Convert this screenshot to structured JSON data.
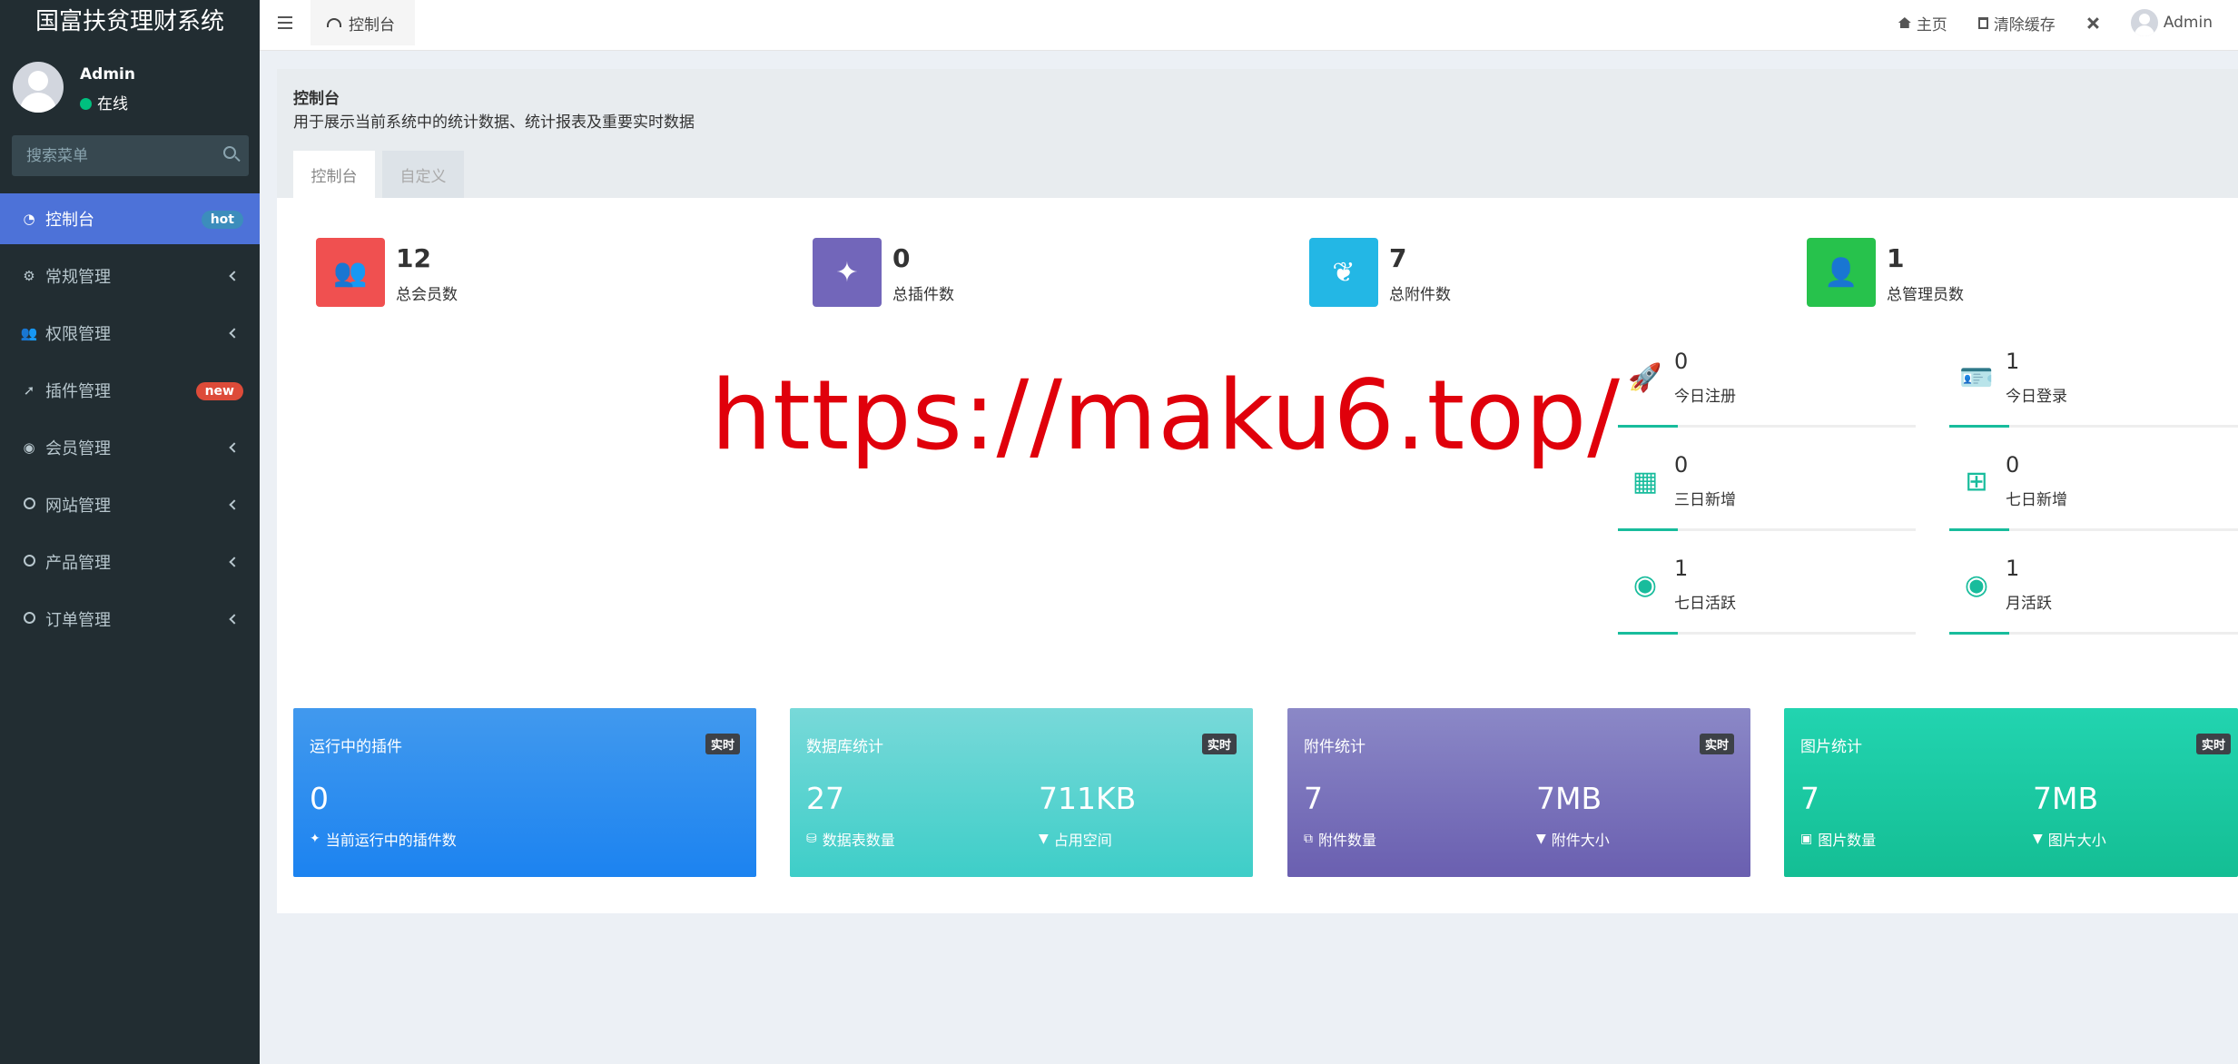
{
  "app": {
    "title": "国富扶贫理财系统"
  },
  "user": {
    "name": "Admin",
    "status": "在线"
  },
  "search": {
    "placeholder": "搜索菜单"
  },
  "menu": [
    {
      "label": "控制台",
      "badge": "hot"
    },
    {
      "label": "常规管理"
    },
    {
      "label": "权限管理"
    },
    {
      "label": "插件管理",
      "badge": "new"
    },
    {
      "label": "会员管理"
    },
    {
      "label": "网站管理"
    },
    {
      "label": "产品管理"
    },
    {
      "label": "订单管理"
    }
  ],
  "header": {
    "tab": "控制台",
    "home": "主页",
    "clear_cache": "清除缓存",
    "user": "Admin"
  },
  "panel": {
    "title": "控制台",
    "subtitle": "用于展示当前系统中的统计数据、统计报表及重要实时数据",
    "tabs": [
      "控制台",
      "自定义"
    ]
  },
  "stats": [
    {
      "value": "12",
      "label": "总会员数",
      "color": "#f05050"
    },
    {
      "value": "0",
      "label": "总插件数",
      "color": "#7266ba"
    },
    {
      "value": "7",
      "label": "总附件数",
      "color": "#23b7e5"
    },
    {
      "value": "1",
      "label": "总管理员数",
      "color": "#27c24c"
    }
  ],
  "mini_stats": [
    {
      "value": "0",
      "label": "今日注册"
    },
    {
      "value": "1",
      "label": "今日登录"
    },
    {
      "value": "0",
      "label": "三日新增"
    },
    {
      "value": "0",
      "label": "七日新增"
    },
    {
      "value": "1",
      "label": "七日活跃"
    },
    {
      "value": "1",
      "label": "月活跃"
    }
  ],
  "watermark": "https://maku6.top/",
  "cards": [
    {
      "title": "运行中的插件",
      "tag": "实时",
      "value1": "0",
      "label1": "当前运行中的插件数"
    },
    {
      "title": "数据库统计",
      "tag": "实时",
      "value1": "27",
      "label1": "数据表数量",
      "value2": "711KB",
      "label2": "占用空间"
    },
    {
      "title": "附件统计",
      "tag": "实时",
      "value1": "7",
      "label1": "附件数量",
      "value2": "7MB",
      "label2": "附件大小"
    },
    {
      "title": "图片统计",
      "tag": "实时",
      "value1": "7",
      "label1": "图片数量",
      "value2": "7MB",
      "label2": "图片大小"
    }
  ]
}
